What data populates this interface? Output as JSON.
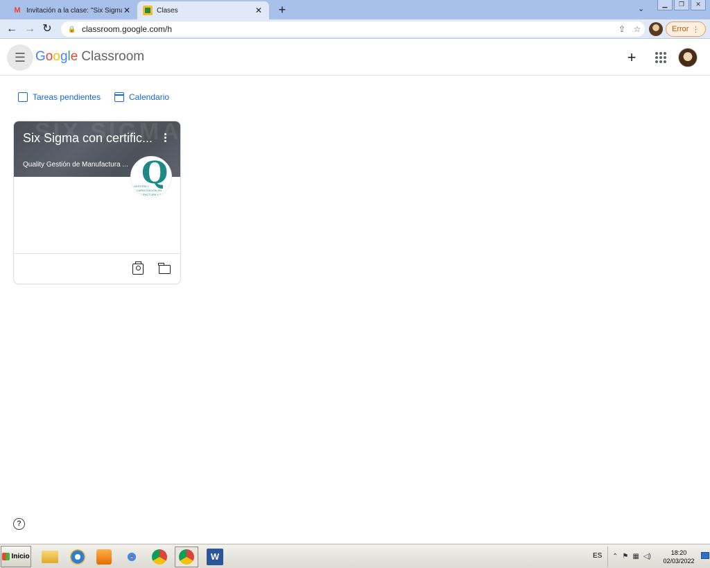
{
  "browser": {
    "tabs": [
      {
        "title": "Invitación a la clase: \"Six Sigma con c",
        "favicon": "gmail-icon",
        "active": false
      },
      {
        "title": "Clases",
        "favicon": "classroom-icon",
        "active": true
      }
    ],
    "new_tab_label": "+",
    "url": "classroom.google.com/h",
    "error_chip_label": "Error"
  },
  "header": {
    "logo": {
      "g1": "G",
      "g2": "o",
      "g3": "o",
      "g4": "g",
      "g5": "l",
      "g6": "e"
    },
    "product": "Classroom"
  },
  "links": {
    "todo_label": "Tareas pendientes",
    "calendar_label": "Calendario"
  },
  "class_card": {
    "title": "Six Sigma con certific...",
    "section": "Quality Gestión de Manufactura ...",
    "owner_logo": {
      "letter": "Q",
      "line1": "GESTIÓN Y",
      "line2": "CAPACITACIÓN EN",
      "line3": "NUFACTURA Y SEGU"
    }
  },
  "taskbar": {
    "start_label": "Inicio",
    "language": "ES",
    "clock_time": "18:20",
    "clock_date": "02/03/2022"
  },
  "colors": {
    "link_blue": "#1967d2",
    "tabstrip": "#a8c1ea",
    "banner": "#4f535c",
    "logo_teal": "#1d8a86"
  }
}
